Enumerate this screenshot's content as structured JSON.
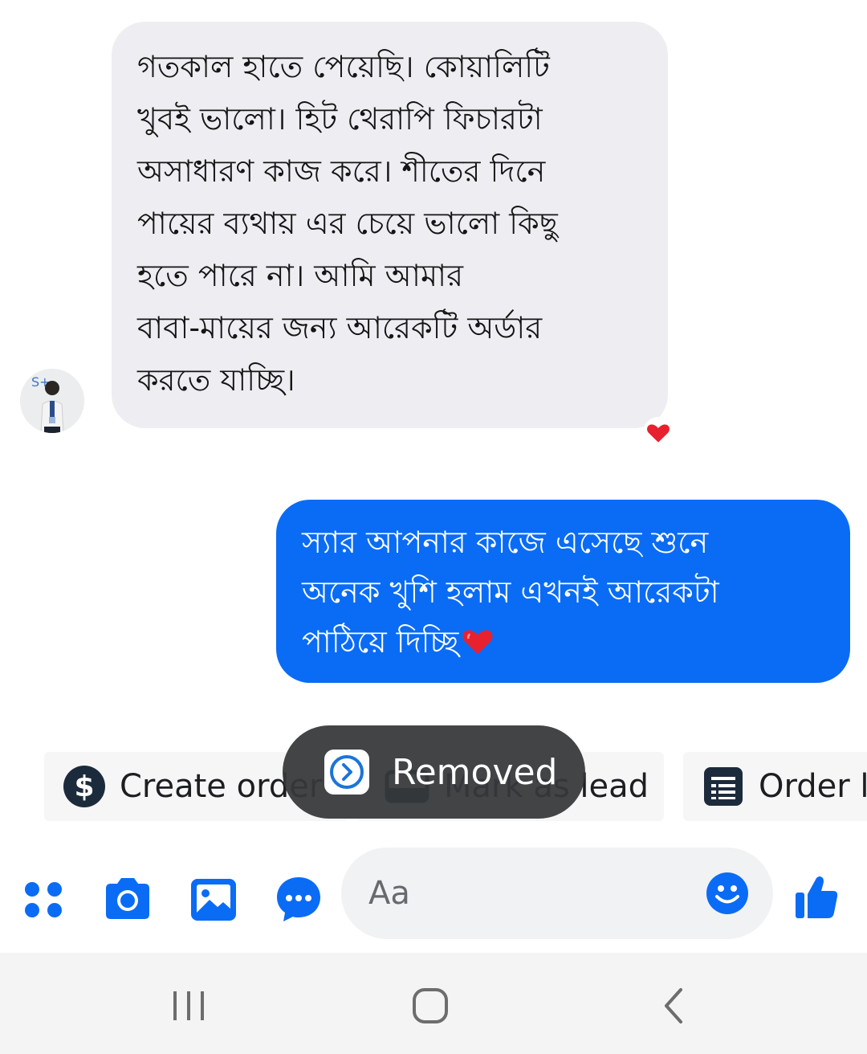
{
  "conversation": {
    "incoming": {
      "text": "গতকাল হাতে পেয়েছি। কোয়ালিটি\nখুবই ভালো। হিট থেরাপি ফিচারটা\nঅসাধারণ কাজ করে। শীতের দিনে\nপায়ের ব্যথায় এর চেয়ে ভালো কিছু\nহতে পারে না। আমি আমার\nবাবা-মায়ের জন্য আরেকটি অর্ডার\nকরতে যাচ্ছি।",
      "reaction": "heart",
      "avatar_badge": "S+"
    },
    "outgoing": {
      "text": "স্যার আপনার কাজে এসেছে শুনে\nঅনেক খুশি হলাম   এখনই আরেকটা\nপাঠিয়ে দিচ্ছি"
    }
  },
  "quick_actions": {
    "create_order": "Create order",
    "mark_as_lead": "Mark as lead",
    "order": "Order l"
  },
  "toast": {
    "label": "Removed"
  },
  "composer": {
    "placeholder": "Aa"
  },
  "colors": {
    "accent": "#0a6cf5",
    "incoming_bubble": "#eeeef2",
    "heart": "#e8212f",
    "toast_bg": "#36383a"
  }
}
